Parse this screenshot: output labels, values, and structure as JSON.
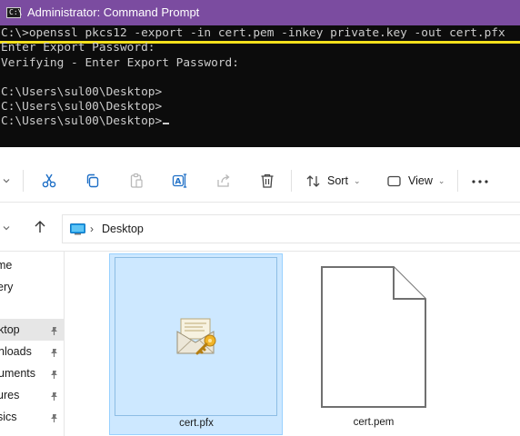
{
  "cmd": {
    "title": "Administrator: Command Prompt",
    "icon_text": "C:\\",
    "lines": [
      "C:\\>openssl pkcs12 -export -in cert.pem -inkey private.key -out cert.pfx",
      "Enter Export Password:",
      "Verifying - Enter Export Password:",
      "",
      "C:\\Users\\sul00\\Desktop>",
      "C:\\Users\\sul00\\Desktop>",
      "C:\\Users\\sul00\\Desktop>"
    ],
    "highlight_color": "#f4e01c",
    "titlebar_color": "#7b4ca0"
  },
  "toolbar": {
    "icons": [
      "chevron-icon",
      "cut-icon",
      "copy-icon",
      "paste-icon",
      "rename-icon",
      "share-icon",
      "delete-icon"
    ],
    "sort_label": "Sort",
    "view_label": "View",
    "more_label": "···",
    "accent": "#1e6fc6"
  },
  "address": {
    "breadcrumb": [
      "Desktop"
    ]
  },
  "nav": {
    "items": [
      {
        "label": "Home",
        "partial": "me",
        "selected": false,
        "pinned": false
      },
      {
        "label": "Gallery",
        "partial": "ery",
        "selected": false,
        "pinned": false
      },
      {
        "label": "Desktop",
        "partial": "ktop",
        "selected": true,
        "pinned": true
      },
      {
        "label": "Downloads",
        "partial": "nloads",
        "selected": false,
        "pinned": true
      },
      {
        "label": "Documents",
        "partial": "uments",
        "selected": false,
        "pinned": true
      },
      {
        "label": "Pictures",
        "partial": "ures",
        "selected": false,
        "pinned": true
      },
      {
        "label": "Music",
        "partial": "sics",
        "selected": false,
        "pinned": true
      }
    ]
  },
  "files": [
    {
      "name": "cert.pfx",
      "selected": true,
      "icon": "certificate-icon"
    },
    {
      "name": "cert.pem",
      "selected": false,
      "icon": "blank-file-icon"
    }
  ],
  "selection_color": "#cde8ff"
}
